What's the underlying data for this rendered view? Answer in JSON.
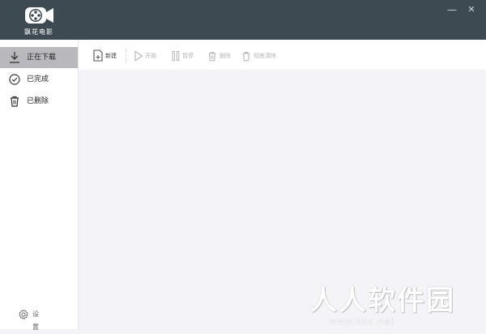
{
  "app": {
    "logo_text": "飘花电影"
  },
  "window_controls": {
    "minimize": "—",
    "close": "✕"
  },
  "sidebar": {
    "items": [
      {
        "label": "正在下载",
        "icon": "download-icon",
        "active": true
      },
      {
        "label": "已完成",
        "icon": "check-circle-icon",
        "active": false
      },
      {
        "label": "已删除",
        "icon": "trash-icon",
        "active": false
      }
    ],
    "settings_label": "设置"
  },
  "toolbar": {
    "new_label": "新建",
    "start_label": "开始",
    "pause_label": "暂停",
    "delete_label": "删除",
    "clear_completed_label": "彻底清除"
  },
  "watermark": {
    "title": "人人软件园",
    "url": "www.kkx.net"
  },
  "colors": {
    "titlebar": "#3e4a52",
    "active_item": "#b9b9bd",
    "content_bg": "#f4f4f8"
  }
}
